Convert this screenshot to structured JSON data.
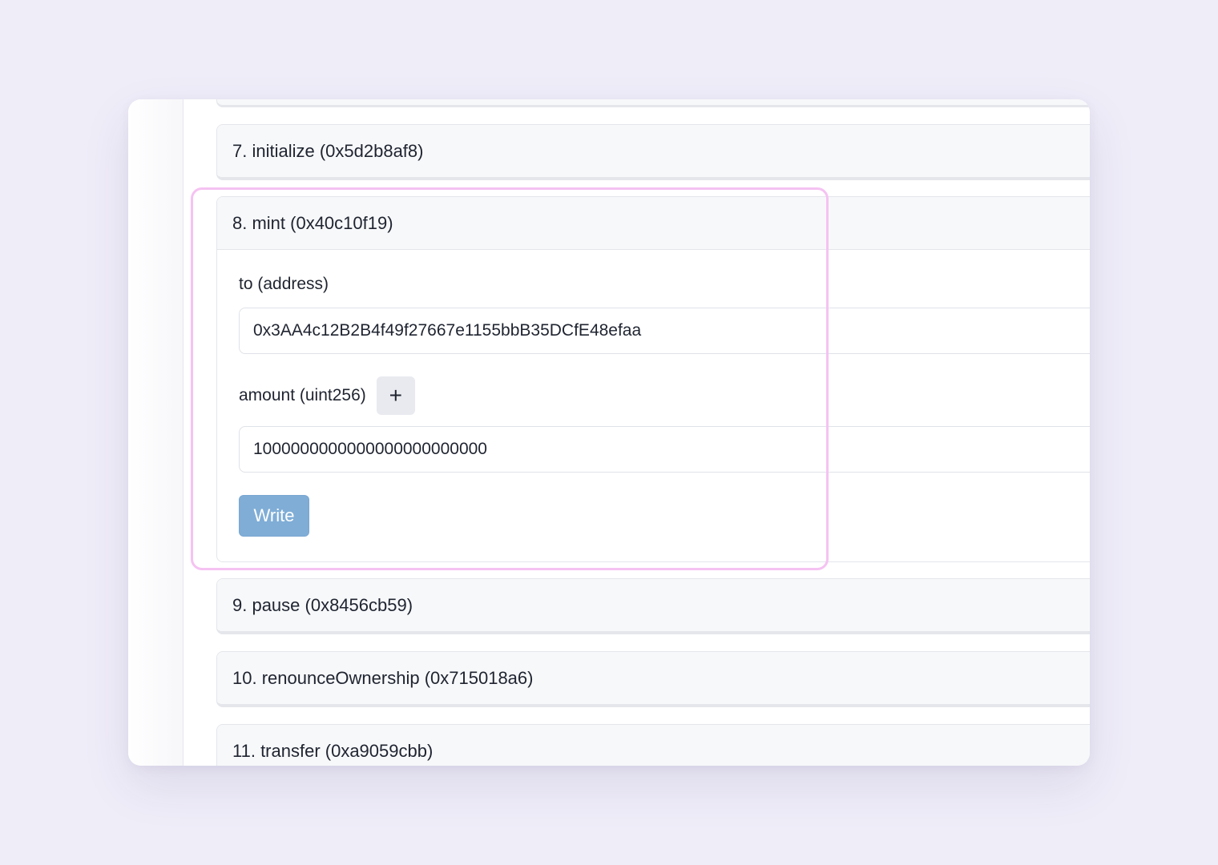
{
  "functions": [
    {
      "label": "7. initialize (0x5d2b8af8)"
    },
    {
      "label": "8. mint (0x40c10f19)",
      "inputs": {
        "to_label": "to (address)",
        "to_value": "0x3AA4c12B2B4f49f27667e1155bbB35DCfE48efaa",
        "amount_label": "amount (uint256)",
        "amount_plus": "+",
        "amount_value": "1000000000000000000000000"
      },
      "write_label": "Write"
    },
    {
      "label": "9. pause (0x8456cb59)"
    },
    {
      "label": "10. renounceOwnership (0x715018a6)"
    },
    {
      "label": "11. transfer (0xa9059cbb)"
    }
  ],
  "colors": {
    "background": "#efedf8",
    "highlight": "#f5c2f2",
    "write_button": "#7fadd6"
  }
}
